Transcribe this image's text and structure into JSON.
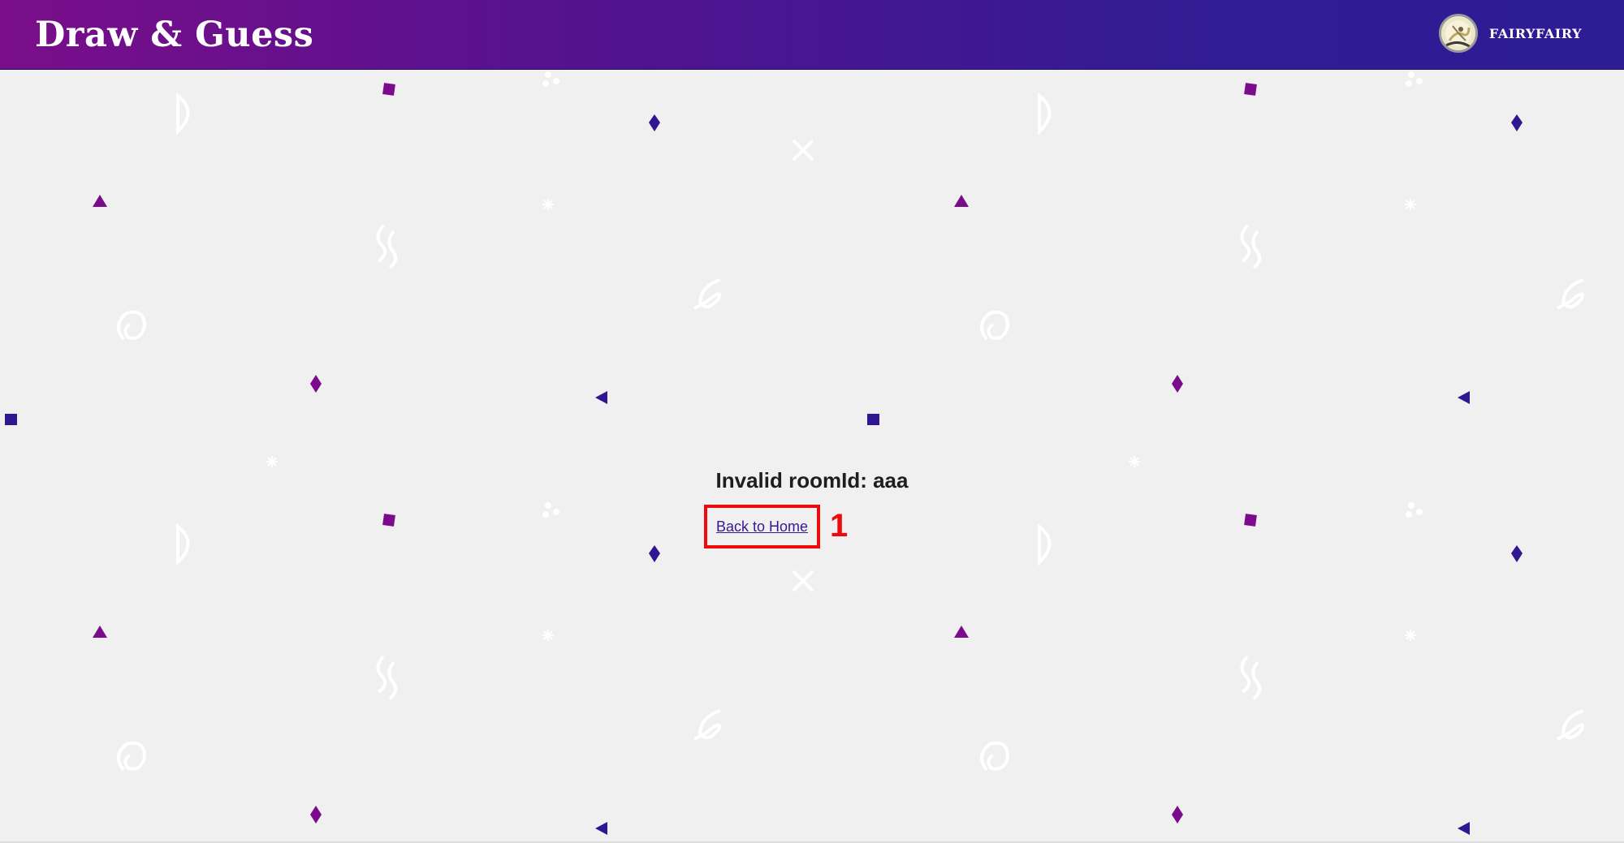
{
  "header": {
    "logo": "Draw & Guess",
    "username": "FAIRYFAIRY"
  },
  "error": {
    "message": "Invalid roomId: aaa",
    "link_label": "Back to Home"
  },
  "annotation": {
    "label": "1"
  },
  "colors": {
    "header_start": "#7a0e8a",
    "header_end": "#2e1c94",
    "purple_shape": "#7b0b8c",
    "indigo_shape": "#2e1791",
    "annotation_red": "#ee0a0a",
    "page_bg": "#f0f0f0"
  }
}
